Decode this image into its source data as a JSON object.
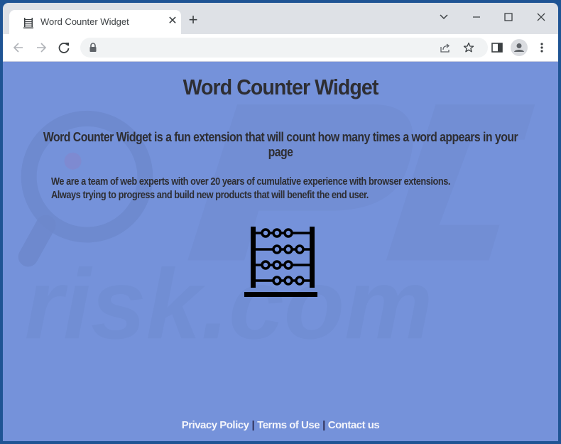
{
  "browser": {
    "tab": {
      "title": "Word Counter Widget",
      "favicon": "abacus-icon",
      "close_icon": "close-icon"
    },
    "new_tab_icon": "plus-icon",
    "window_controls": [
      "chevron-down-icon",
      "minimize-icon",
      "maximize-icon",
      "close-icon"
    ],
    "toolbar": {
      "back_icon": "arrow-left-icon",
      "forward_icon": "arrow-right-icon",
      "reload_icon": "reload-icon",
      "lock_icon": "lock-icon",
      "url": "",
      "share_icon": "share-icon",
      "bookmark_icon": "star-icon",
      "sidepanel_icon": "side-panel-icon",
      "profile_icon": "profile-icon",
      "menu_icon": "kebab-menu-icon"
    }
  },
  "page": {
    "title": "Word Counter Widget",
    "tagline": "Word Counter Widget is a fun extension that will count how many times a word appears in your page",
    "description_lines": [
      "We are a team of web experts with over 20 years of cumulative experience with browser extensions.",
      "Always trying to progress and build new products that will benefit the end user."
    ],
    "image_icon": "abacus-icon",
    "footer": {
      "links": [
        "Privacy Policy",
        "Terms of Use",
        "Contact us"
      ],
      "separator": "|"
    },
    "colors": {
      "background": "#7592da",
      "text": "#2e2e33",
      "footer_text": "#f4f5fb"
    }
  }
}
